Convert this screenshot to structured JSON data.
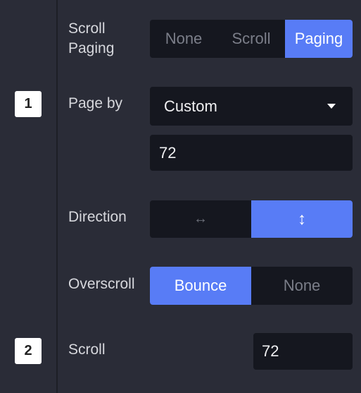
{
  "badges": [
    "1",
    "2"
  ],
  "scroll_paging": {
    "label": "Scroll Paging",
    "label_line1": "Scroll",
    "label_line2": "Paging",
    "options": [
      "None",
      "Scroll",
      "Paging"
    ],
    "selected": "Paging"
  },
  "page_by": {
    "label": "Page by",
    "value": "Custom",
    "amount": "72"
  },
  "direction": {
    "label": "Direction",
    "options": [
      "horizontal-arrow-icon",
      "vertical-arrow-icon"
    ],
    "glyphs": [
      "↔",
      "↕"
    ],
    "selected": "vertical"
  },
  "overscroll": {
    "label": "Overscroll",
    "options": [
      "Bounce",
      "None"
    ],
    "selected": "Bounce"
  },
  "scroll": {
    "label": "Scroll",
    "value": "72"
  },
  "colors": {
    "accent": "#587cf6",
    "background": "#2a2c37",
    "control": "#15171f"
  }
}
